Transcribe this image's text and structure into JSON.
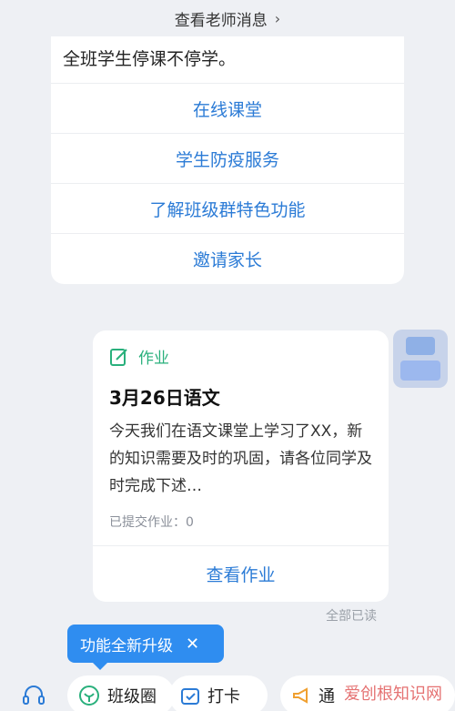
{
  "top_link": {
    "label": "查看老师消息",
    "chevron": "›"
  },
  "menu_card": {
    "intro": "全班学生停课不停学。",
    "items": [
      "在线课堂",
      "学生防疫服务",
      "了解班级群特色功能",
      "邀请家长"
    ]
  },
  "homework_card": {
    "tag": "作业",
    "title": "3月26日语文",
    "desc": "今天我们在语文课堂上学习了XX，新的知识需要及时的巩固，请各位同学及时完成下述…",
    "submitted": "已提交作业：0",
    "view": "查看作业",
    "tag_icon": "edit-note-icon"
  },
  "read_status": "全部已读",
  "upgrade_tip": {
    "label": "功能全新升级",
    "close": "✕"
  },
  "bottom_tabs": [
    {
      "label": "班级圈",
      "icon": "leaf-circle-icon"
    },
    {
      "label": "打卡",
      "icon": "checkbox-calendar-icon"
    },
    {
      "label": "通",
      "icon": "megaphone-icon"
    }
  ],
  "watermark": "爱创根知识网",
  "colors": {
    "accent_blue": "#2b7bd6",
    "green": "#29b07c",
    "tip_bg": "#2f8df0"
  }
}
